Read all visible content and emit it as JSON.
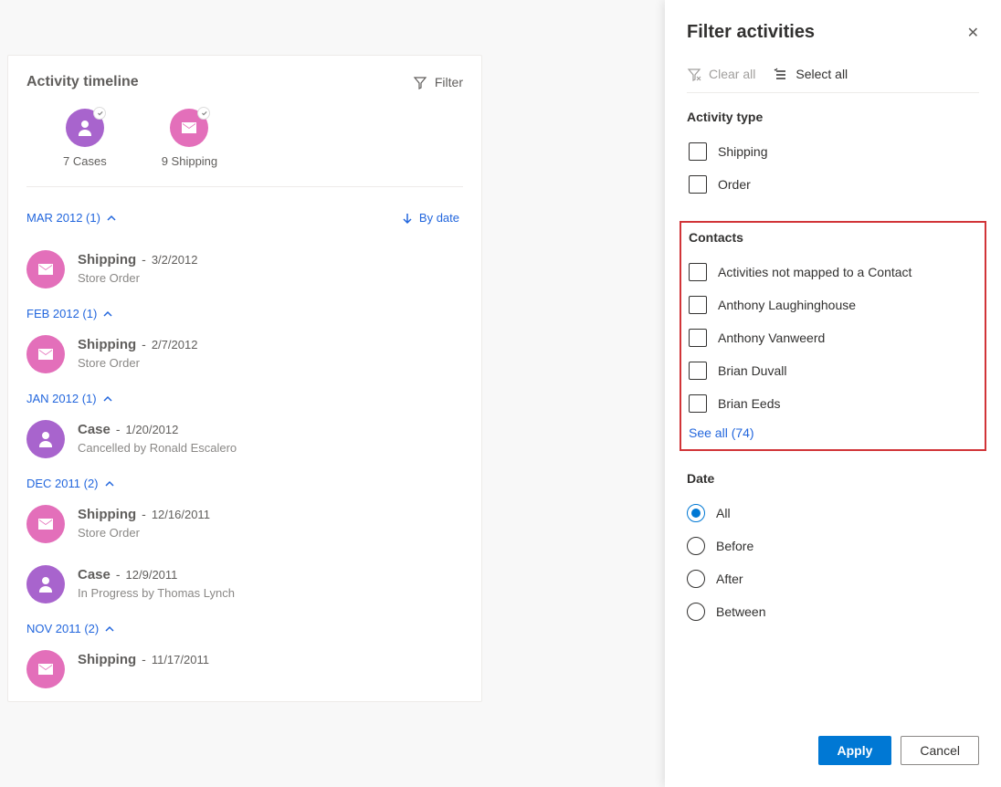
{
  "timeline": {
    "title": "Activity timeline",
    "filter_label": "Filter",
    "sort_label": "By date",
    "summary": [
      {
        "label": "7 Cases",
        "color": "purple",
        "icon": "person"
      },
      {
        "label": "9 Shipping",
        "color": "pink",
        "icon": "mail"
      }
    ],
    "groups": [
      {
        "header": "MAR 2012 (1)",
        "items": [
          {
            "type": "Shipping",
            "date": "3/2/2012",
            "sub": "Store Order",
            "icon": "mail",
            "color": "pink"
          }
        ]
      },
      {
        "header": "FEB 2012 (1)",
        "items": [
          {
            "type": "Shipping",
            "date": "2/7/2012",
            "sub": "Store Order",
            "icon": "mail",
            "color": "pink"
          }
        ]
      },
      {
        "header": "JAN 2012 (1)",
        "items": [
          {
            "type": "Case",
            "date": "1/20/2012",
            "sub": "Cancelled by Ronald Escalero",
            "icon": "person",
            "color": "purple"
          }
        ]
      },
      {
        "header": "DEC 2011 (2)",
        "items": [
          {
            "type": "Shipping",
            "date": "12/16/2011",
            "sub": "Store Order",
            "icon": "mail",
            "color": "pink"
          },
          {
            "type": "Case",
            "date": "12/9/2011",
            "sub": "In Progress by Thomas Lynch",
            "icon": "person",
            "color": "purple"
          }
        ]
      },
      {
        "header": "NOV 2011 (2)",
        "items": [
          {
            "type": "Shipping",
            "date": "11/17/2011",
            "sub": "",
            "icon": "mail",
            "color": "pink"
          }
        ]
      }
    ]
  },
  "panel": {
    "title": "Filter activities",
    "clear_all": "Clear all",
    "select_all": "Select all",
    "activity_type_label": "Activity type",
    "activity_types": [
      "Shipping",
      "Order"
    ],
    "contacts_label": "Contacts",
    "contacts": [
      "Activities not mapped to a Contact",
      "Anthony Laughinghouse",
      "Anthony Vanweerd",
      "Brian Duvall",
      "Brian Eeds"
    ],
    "see_all": "See all (74)",
    "date_label": "Date",
    "date_options": [
      "All",
      "Before",
      "After",
      "Between"
    ],
    "date_selected": "All",
    "apply": "Apply",
    "cancel": "Cancel"
  }
}
